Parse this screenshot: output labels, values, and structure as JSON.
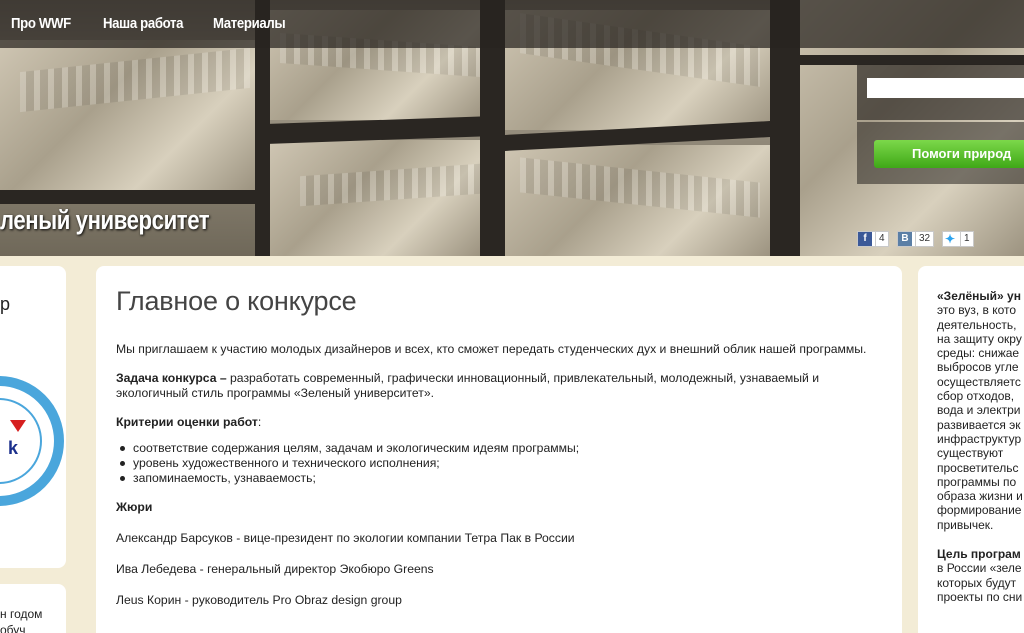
{
  "nav": {
    "items": [
      "Про WWF",
      "Наша работа",
      "Материалы"
    ]
  },
  "header": {
    "site_title": "леный университет"
  },
  "search": {
    "placeholder": ""
  },
  "donate": {
    "label": "Помоги природ"
  },
  "share": {
    "facebook_count": "4",
    "vk_count": "32",
    "twitter_count": "1",
    "vk_label": "B"
  },
  "left": {
    "fragment": "р",
    "badge_text": "k",
    "bottom_lines": [
      "н годом",
      "обуч"
    ]
  },
  "main": {
    "title": "Главное о конкурсе",
    "intro": "Мы приглашаем к участию молодых дизайнеров и всех, кто сможет передать студенческих  дух и внешний облик нашей программы.",
    "task_label": "Задача конкурса –",
    "task_text": " разработать современный, графически инновационный, привлекательный, молодежный, узнаваемый и  экологичный стиль программы «Зеленый университет».",
    "criteria_title": "Критерии оценки работ",
    "criteria_colon": ":",
    "criteria": [
      "соответствие содержания целям, задачам  и экологическим идеям программы;",
      "уровень художественного и технического исполнения;",
      "запоминаемость, узнаваемость;"
    ],
    "jury_title": "Жюри",
    "jury": [
      "Александр Барсуков - вице-президент по экологии компании Тетра Пак в России",
      "Ива Лебедева - генеральный директор Экобюро Greens",
      "Леus Корин - руководитель Pro Obraz design group"
    ]
  },
  "right": {
    "heading": "«Зелёный» ун",
    "lines": [
      "это вуз, в кото",
      "деятельность,",
      "на защиту окру",
      "среды: снижае",
      "выбросов угле",
      "осуществляетс",
      "сбор отходов,",
      "вода и электри",
      "развивается эк",
      "инфраструктур",
      "существуют",
      "просветительс",
      "программы по",
      "образа жизни и",
      "формирование",
      "привычек."
    ],
    "goal_heading": "Цель програм",
    "goal_lines": [
      "в России «зеле",
      "которых будут",
      "проекты по сни"
    ]
  }
}
